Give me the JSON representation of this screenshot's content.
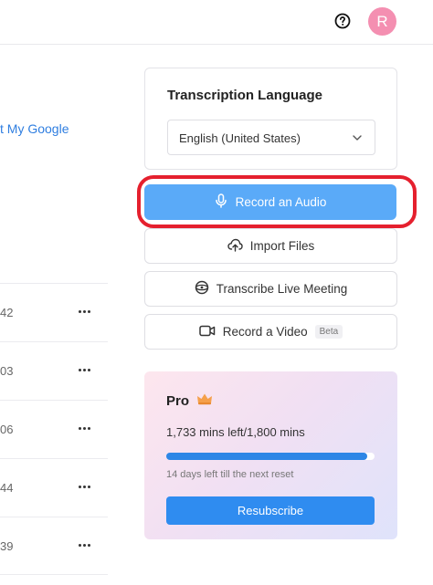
{
  "header": {
    "help_icon": "question-circle-icon",
    "avatar_initial": "R",
    "avatar_color": "#f48fb1"
  },
  "main": {
    "link_text": "t My Google",
    "files": [
      {
        "value": "42"
      },
      {
        "value": "03"
      },
      {
        "value": "06"
      },
      {
        "value": "44"
      },
      {
        "value": "39"
      }
    ]
  },
  "transcription": {
    "title": "Transcription Language",
    "language_selected": "English (United States)"
  },
  "actions": {
    "record_audio": "Record an Audio",
    "import_files": "Import Files",
    "live_meeting": "Transcribe Live Meeting",
    "record_video": "Record a Video",
    "beta_badge": "Beta"
  },
  "pro": {
    "title": "Pro",
    "mins_left": "1,733 mins left/1,800 mins",
    "used_fraction": 0.963,
    "reset_text": "14 days left till the next reset",
    "resubscribe": "Resubscribe"
  },
  "colors": {
    "accent": "#5aaaf8",
    "primary_button": "#2f8cf0",
    "highlight": "#e5202e",
    "link": "#2f7ee0"
  }
}
